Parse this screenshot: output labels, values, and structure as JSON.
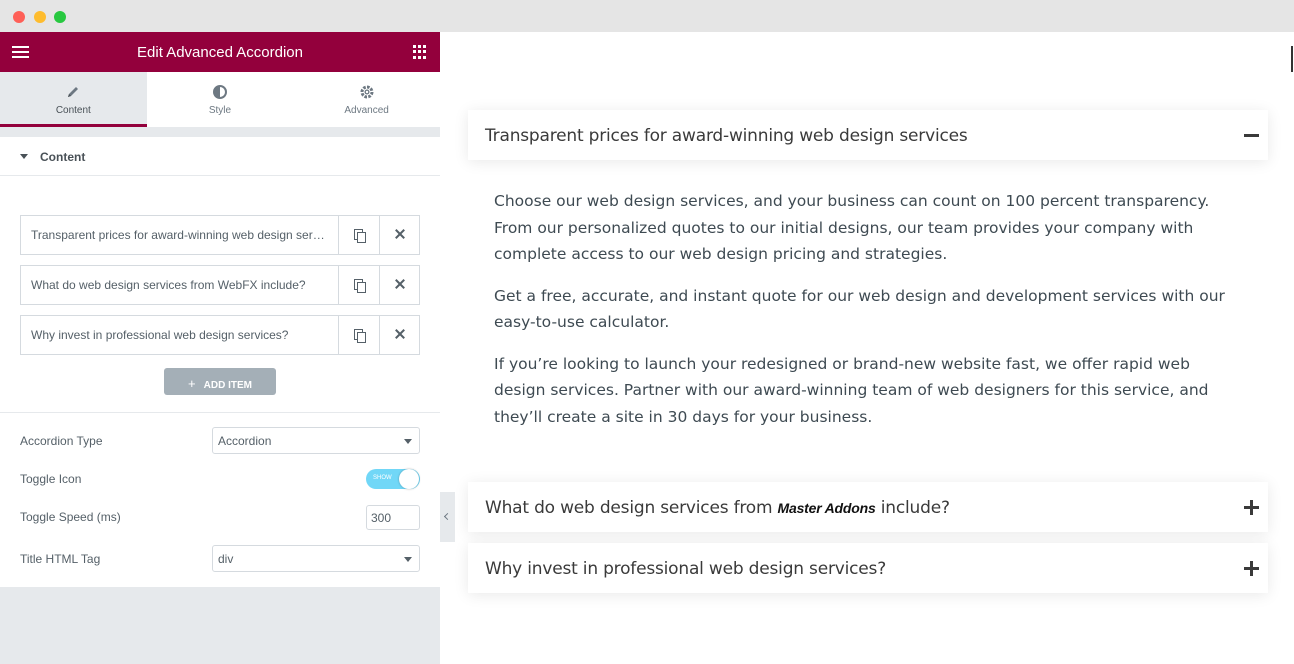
{
  "panel": {
    "title": "Edit Advanced Accordion",
    "tabs": [
      {
        "label": "Content",
        "icon": "pencil-icon",
        "active": true
      },
      {
        "label": "Style",
        "icon": "half-circle-icon",
        "active": false
      },
      {
        "label": "Advanced",
        "icon": "gear-icon",
        "active": false
      }
    ],
    "section_title": "Content",
    "items": [
      "Transparent prices for award-winning web design services",
      "What do web design services from WebFX include?",
      "Why invest in professional web design services?"
    ],
    "add_item_label": "ADD ITEM",
    "add_item_plus": "+",
    "controls": {
      "accordion_type_label": "Accordion Type",
      "accordion_type_value": "Accordion",
      "toggle_icon_label": "Toggle Icon",
      "toggle_icon_state": "SHOW",
      "toggle_speed_label": "Toggle Speed (ms)",
      "toggle_speed_value": "300",
      "title_tag_label": "Title HTML Tag",
      "title_tag_value": "div"
    },
    "accent_color": "#93003c"
  },
  "preview": {
    "accordion": [
      {
        "title": "Transparent prices for award-winning web design services",
        "expanded": true
      },
      {
        "title_before": "What do web design services from ",
        "title_brand": "Master Addons",
        "title_after": " include?",
        "expanded": false
      },
      {
        "title": "Why invest in professional web design services?",
        "expanded": false
      }
    ],
    "body_paragraphs": [
      "Choose our web design services, and your business can count on 100 percent transparency. From our personalized quotes to our initial designs, our team provides your company with complete access to our web design pricing and strategies.",
      "Get a free, accurate, and instant quote for our web design and development services with our easy-to-use calculator.",
      "If you’re looking to launch your redesigned or brand-new website fast, we offer rapid web design services. Partner with our award-winning team of web designers for this service, and they’ll create a site in 30 days for your business."
    ]
  }
}
